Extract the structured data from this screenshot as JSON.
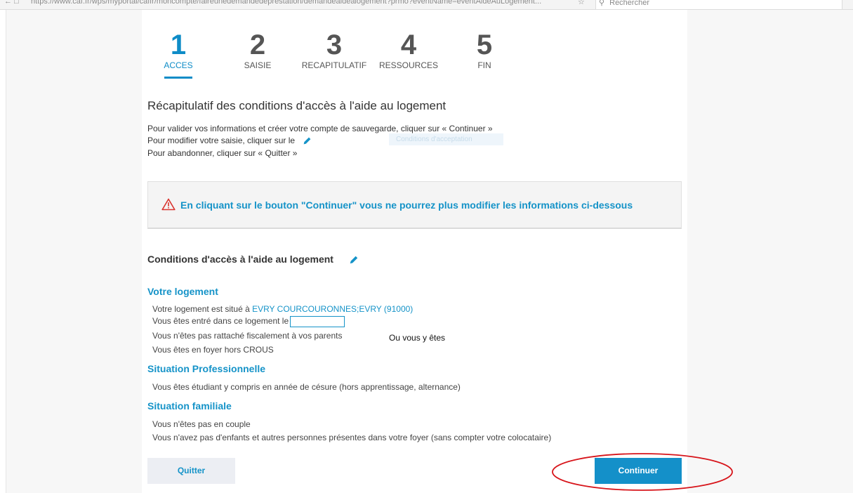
{
  "browser": {
    "nav_icon": "back-arrow-icon",
    "url": "https://www.caf.fr/wps/myportal/caffr/moncompte/faireunedemandedeprestation/demandeaidealogement?prmo?eventName=eventAideAuLogement...",
    "search_placeholder": "Rechercher"
  },
  "steps": [
    {
      "num": "1",
      "label": "ACCES",
      "active": true
    },
    {
      "num": "2",
      "label": "SAISIE",
      "active": false
    },
    {
      "num": "3",
      "label": "RECAPITULATIF",
      "active": false
    },
    {
      "num": "4",
      "label": "RESSOURCES",
      "active": false
    },
    {
      "num": "5",
      "label": "FIN",
      "active": false
    }
  ],
  "page_title": "Récapitulatif des conditions d'accès à l'aide au logement",
  "intro": {
    "line1": "Pour valider vos informations et créer votre compte de sauvegarde, cliquer sur « Continuer »",
    "line2": "Pour modifier votre saisie, cliquer sur le",
    "line3": "Pour abandonner, cliquer sur « Quitter »",
    "ghost_badge": "Conditions d'acceptation"
  },
  "warning": {
    "text": "En cliquant sur le bouton \"Continuer\" vous ne pourrez plus modifier les informations ci-dessous"
  },
  "conditions": {
    "title": "Conditions d'accès à l'aide au logement",
    "logement": {
      "title": "Votre logement",
      "location_prefix": "Votre logement est situé à ",
      "location_value": "EVRY COURCOURONNES;EVRY (91000)",
      "entry_text": "Vous êtes entré dans ce logement le",
      "entry_date": "",
      "fiscal_text": "Vous n'êtes pas rattaché fiscalement à vos parents",
      "foyer_text": "Vous êtes en foyer hors CROUS"
    },
    "pro": {
      "title": "Situation Professionnelle",
      "text": "Vous êtes étudiant y compris en année de césure (hors apprentissage, alternance)"
    },
    "famille": {
      "title": "Situation familiale",
      "line1": "Vous n'êtes pas en couple",
      "line2": "Vous n'avez pas d'enfants et autres personnes présentes dans votre foyer (sans compter votre colocataire)"
    }
  },
  "annotation_note": "Ou vous y êtes",
  "buttons": {
    "quit": "Quitter",
    "continue": "Continuer"
  },
  "colors": {
    "accent": "#1593c8",
    "button_primary": "#1490c9",
    "highlight": "#d7141a"
  }
}
